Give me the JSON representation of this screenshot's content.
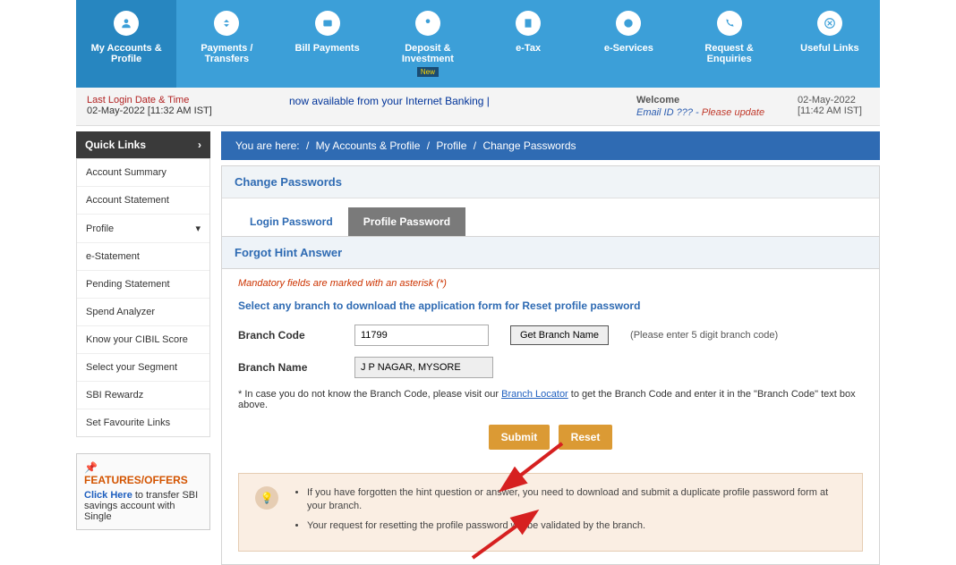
{
  "topnav": [
    {
      "label": "My Accounts & Profile",
      "active": true
    },
    {
      "label": "Payments / Transfers"
    },
    {
      "label": "Bill Payments"
    },
    {
      "label": "Deposit & Investment",
      "badge": "New"
    },
    {
      "label": "e-Tax"
    },
    {
      "label": "e-Services"
    },
    {
      "label": "Request & Enquiries"
    },
    {
      "label": "Useful Links"
    }
  ],
  "infobar": {
    "last_login_label": "Last Login Date & Time",
    "last_login_value": "02-May-2022 [11:32 AM IST]",
    "marquee": "now available from your Internet Banking |",
    "welcome": "Welcome",
    "email_label": "Email ID ??? -",
    "please_update": " Please update",
    "right_date": "02-May-2022",
    "right_time": "[11:42 AM IST]"
  },
  "quicklinks": {
    "title": "Quick Links",
    "items": [
      "Account Summary",
      "Account Statement",
      "Profile",
      "e-Statement",
      "Pending Statement",
      "Spend Analyzer",
      "Know your CIBIL Score",
      "Select your Segment",
      "SBI Rewardz",
      "Set Favourite Links"
    ]
  },
  "features": {
    "title": "FEATURES/OFFERS",
    "link": "Click Here",
    "text": " to transfer SBI savings account with Single"
  },
  "breadcrumb": {
    "here": "You are here:",
    "p1": "My Accounts & Profile",
    "p2": "Profile",
    "p3": "Change Passwords"
  },
  "panel": {
    "title": "Change Passwords",
    "tabs": {
      "login": "Login Password",
      "profile": "Profile Password"
    },
    "section_title": "Forgot Hint Answer",
    "mandatory": "Mandatory fields are marked with an asterisk (*)",
    "select_branch": "Select any branch to download the application form for Reset profile password",
    "branch_code_label": "Branch Code",
    "branch_code_value": "11799",
    "get_branch_btn": "Get Branch Name",
    "branch_code_hint": "(Please enter 5 digit branch code)",
    "branch_name_label": "Branch Name",
    "branch_name_value": "J P NAGAR, MYSORE",
    "note_prefix": "* In case you do not know the Branch Code, please visit our ",
    "note_link": "Branch Locator",
    "note_suffix": " to get the Branch Code and enter it in the \"Branch Code\" text box above.",
    "submit": "Submit",
    "reset": "Reset",
    "info1": "If you have forgotten the hint question or answer, you need to download and submit a duplicate profile password form at your branch.",
    "info2": "Your request for resetting the profile password will be validated by the branch."
  }
}
